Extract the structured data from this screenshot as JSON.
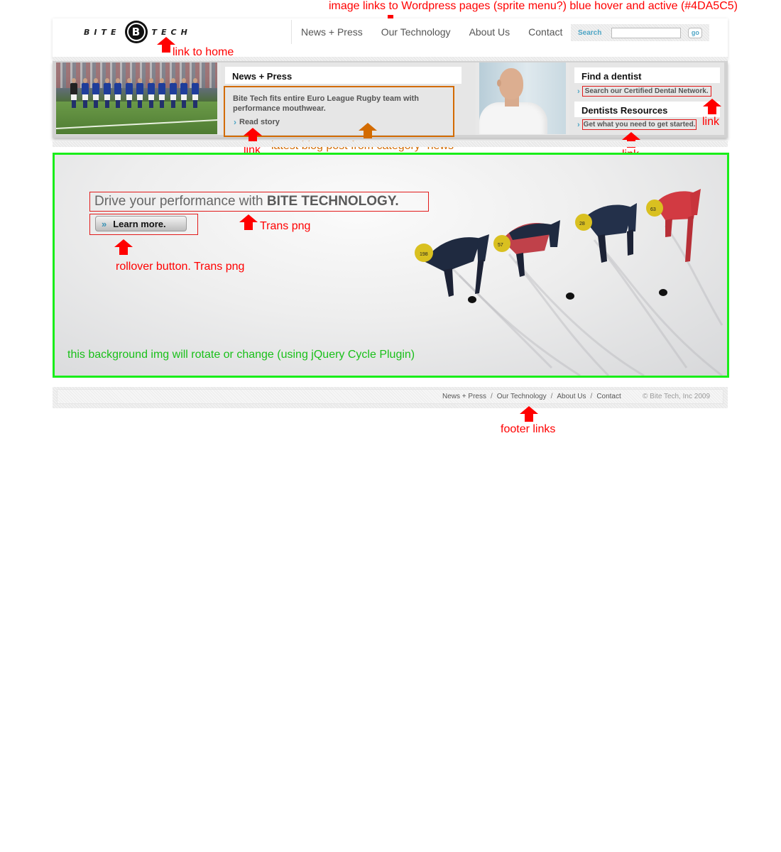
{
  "annotations": {
    "top": "image links to Wordpress pages (sprite menu?) blue hover and active (#4DA5C5)",
    "home": "link to home",
    "news_link": "link",
    "blog_post": "latest blog post from category “news”",
    "dentist_link_1": "link",
    "dentist_link_2": "link",
    "trans_png": "Trans png",
    "rollover": "rollover button. Trans png",
    "rotate": "this background img will rotate or change (using jQuery Cycle Plugin)",
    "footer": "footer links"
  },
  "colors": {
    "accent": "#4DA5C5",
    "annotation_red": "#ff0000",
    "annotation_orange": "#d36b00",
    "annotation_green": "#19ee19"
  },
  "logo": {
    "left_word": "BITE",
    "badge_letter": "B",
    "right_word": "TECH"
  },
  "nav": {
    "items": [
      {
        "label": "News + Press"
      },
      {
        "label": "Our Technology"
      },
      {
        "label": "About Us"
      },
      {
        "label": "Contact"
      }
    ]
  },
  "search": {
    "label": "Search",
    "value": "",
    "go_label": "go"
  },
  "news": {
    "title": "News + Press",
    "story": "Bite Tech fits entire Euro League Rugby team with performance mouthwear.",
    "read_more": "Read story"
  },
  "dentist": {
    "find_title": "Find a dentist",
    "find_link": "Search our Certified Dental Network.",
    "resources_title": "Dentists Resources",
    "resources_link": "Get what you need to get started."
  },
  "hero": {
    "headline_light": "Drive your performance with ",
    "headline_bold": "BITE TECHNOLOGY.",
    "button_label": "Learn more.",
    "skater_numbers": [
      "198",
      "57",
      "28",
      "63"
    ]
  },
  "footer": {
    "links": [
      {
        "label": "News + Press"
      },
      {
        "label": "Our Technology"
      },
      {
        "label": "About Us"
      },
      {
        "label": "Contact"
      }
    ],
    "separator": "/",
    "copyright": "© Bite Tech, Inc 2009"
  }
}
